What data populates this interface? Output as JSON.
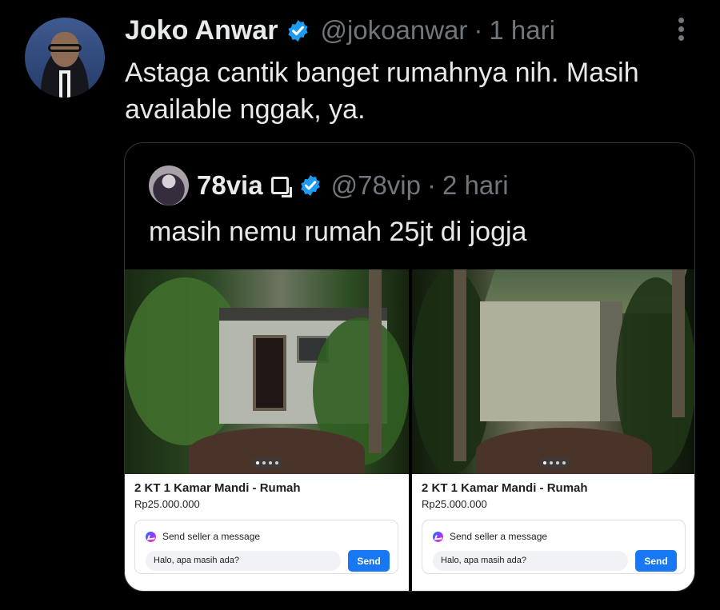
{
  "tweet": {
    "author_name": "Joko Anwar",
    "handle": "@jokoanwar",
    "separator": "·",
    "time": "1 hari",
    "text": "Astaga cantik banget rumahnya nih. Masih available nggak, ya."
  },
  "quote": {
    "author_name": "78via",
    "handle": "@78vip",
    "separator": "·",
    "time": "2 hari",
    "text": "masih nemu rumah 25jt di jogja"
  },
  "listings": [
    {
      "title": "2 KT 1 Kamar Mandi - Rumah",
      "price": "Rp25.000.000",
      "message_label": "Send seller a message",
      "input_value": "Halo, apa masih ada?",
      "send_label": "Send",
      "carousel_page": 1,
      "carousel_total": 4
    },
    {
      "title": "2 KT 1 Kamar Mandi - Rumah",
      "price": "Rp25.000.000",
      "message_label": "Send seller a message",
      "input_value": "Halo, apa masih ada?",
      "send_label": "Send",
      "carousel_page": 1,
      "carousel_total": 4
    }
  ],
  "colors": {
    "background": "#000000",
    "primary_text": "#e7e9ea",
    "secondary_text": "#71767b",
    "verified_blue": "#1d9bf0",
    "send_blue": "#1877f2"
  },
  "icons": [
    "verified-icon",
    "more-icon",
    "square-icon",
    "messenger-icon"
  ]
}
